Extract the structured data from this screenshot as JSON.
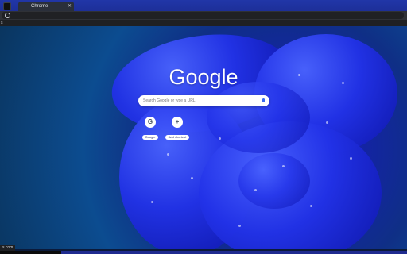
{
  "tab": {
    "title": "Chrome",
    "close_glyph": "✕"
  },
  "bookmarks": {
    "text": "s"
  },
  "ntp": {
    "logo": "Google",
    "search_placeholder": "Search Google or type a URL",
    "shortcuts": [
      {
        "letter": "G",
        "label": "Google"
      },
      {
        "letter": "+",
        "label": "Add shortcut"
      }
    ]
  },
  "status": {
    "text": "s.com"
  },
  "colors": {
    "tabstrip": "#1d2f98",
    "toolbar": "#2f3136",
    "mic": "#3a6af0"
  },
  "icons": {
    "omnibox": "search-icon",
    "shortcut_add": "plus-icon",
    "voice": "mic-icon"
  }
}
